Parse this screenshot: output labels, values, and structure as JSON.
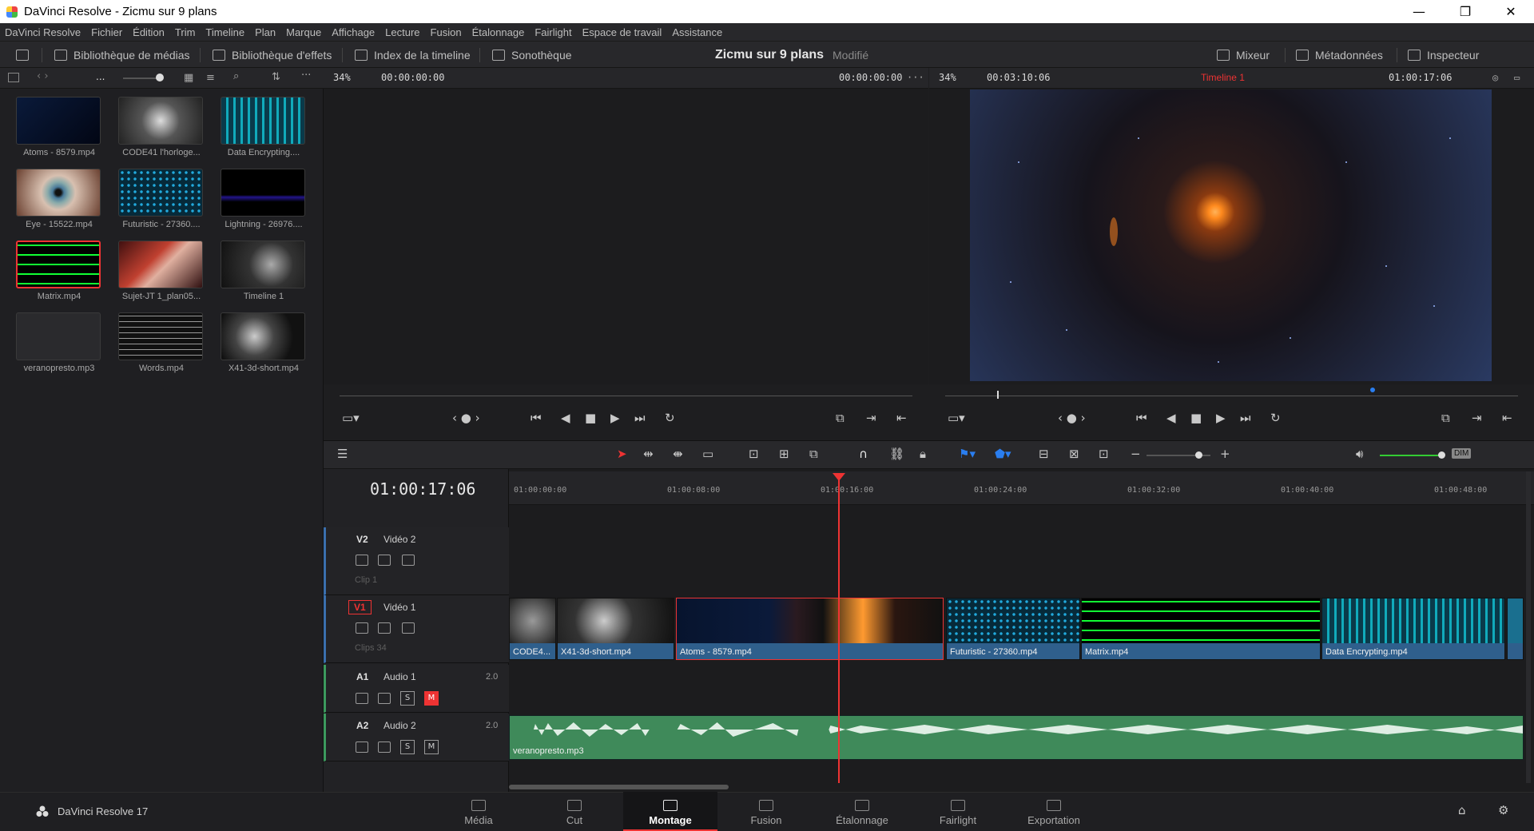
{
  "titlebar": {
    "title": "DaVinci Resolve - Zicmu sur 9 plans"
  },
  "menu": [
    "DaVinci Resolve",
    "Fichier",
    "Édition",
    "Trim",
    "Timeline",
    "Plan",
    "Marque",
    "Affichage",
    "Lecture",
    "Fusion",
    "Étalonnage",
    "Fairlight",
    "Espace de travail",
    "Assistance"
  ],
  "toolbar": {
    "media_lib": "Bibliothèque de médias",
    "effects_lib": "Bibliothèque d'effets",
    "timeline_index": "Index de la timeline",
    "sound_lib": "Sonothèque",
    "project_title": "Zicmu sur 9 plans",
    "project_state": "Modifié",
    "mixer": "Mixeur",
    "metadata": "Métadonnées",
    "inspector": "Inspecteur"
  },
  "mediapool": {
    "clips": [
      {
        "name": "Atoms - 8579.mp4"
      },
      {
        "name": "CODE41 l'horloge..."
      },
      {
        "name": "Data Encrypting...."
      },
      {
        "name": "Eye - 15522.mp4"
      },
      {
        "name": "Futuristic - 27360...."
      },
      {
        "name": "Lightning - 26976...."
      },
      {
        "name": "Matrix.mp4"
      },
      {
        "name": "Sujet-JT 1_plan05..."
      },
      {
        "name": "Timeline 1"
      },
      {
        "name": "veranopresto.mp3"
      },
      {
        "name": "Words.mp4"
      },
      {
        "name": "X41-3d-short.mp4"
      }
    ],
    "more": "..."
  },
  "source": {
    "zoom": "34%",
    "tc_left": "00:00:00:00",
    "tc_right": "00:00:00:00"
  },
  "program": {
    "zoom": "34%",
    "duration": "00:03:10:06",
    "timeline": "Timeline 1",
    "tc": "01:00:17:06"
  },
  "timeline": {
    "timecode": "01:00:17:06",
    "ticks": [
      "01:00:00:00",
      "01:00:08:00",
      "01:00:16:00",
      "01:00:24:00",
      "01:00:32:00",
      "01:00:40:00",
      "01:00:48:00"
    ],
    "tracks": {
      "v2": {
        "id": "V2",
        "name": "Vidéo 2",
        "count": "Clip 1"
      },
      "v1": {
        "id": "V1",
        "name": "Vidéo 1",
        "count": "Clips 34"
      },
      "a1": {
        "id": "A1",
        "name": "Audio 1",
        "ch": "2.0",
        "s": "S",
        "m": "M"
      },
      "a2": {
        "id": "A2",
        "name": "Audio 2",
        "ch": "2.0",
        "s": "S",
        "m": "M"
      }
    },
    "clips": [
      "CODE4...",
      "X41-3d-short.mp4",
      "Atoms - 8579.mp4",
      "Futuristic - 27360.mp4",
      "Matrix.mp4",
      "Data Encrypting.mp4"
    ],
    "audio_clip": "veranopresto.mp3",
    "dim": "DIM"
  },
  "pages": [
    "Média",
    "Cut",
    "Montage",
    "Fusion",
    "Étalonnage",
    "Fairlight",
    "Exportation"
  ],
  "version": "DaVinci Resolve 17",
  "colors": {
    "accent": "#e33c3c",
    "clip_blue": "#2f5f8c",
    "audio_green": "#3f8a5a",
    "active_page": "#e33c3c"
  }
}
